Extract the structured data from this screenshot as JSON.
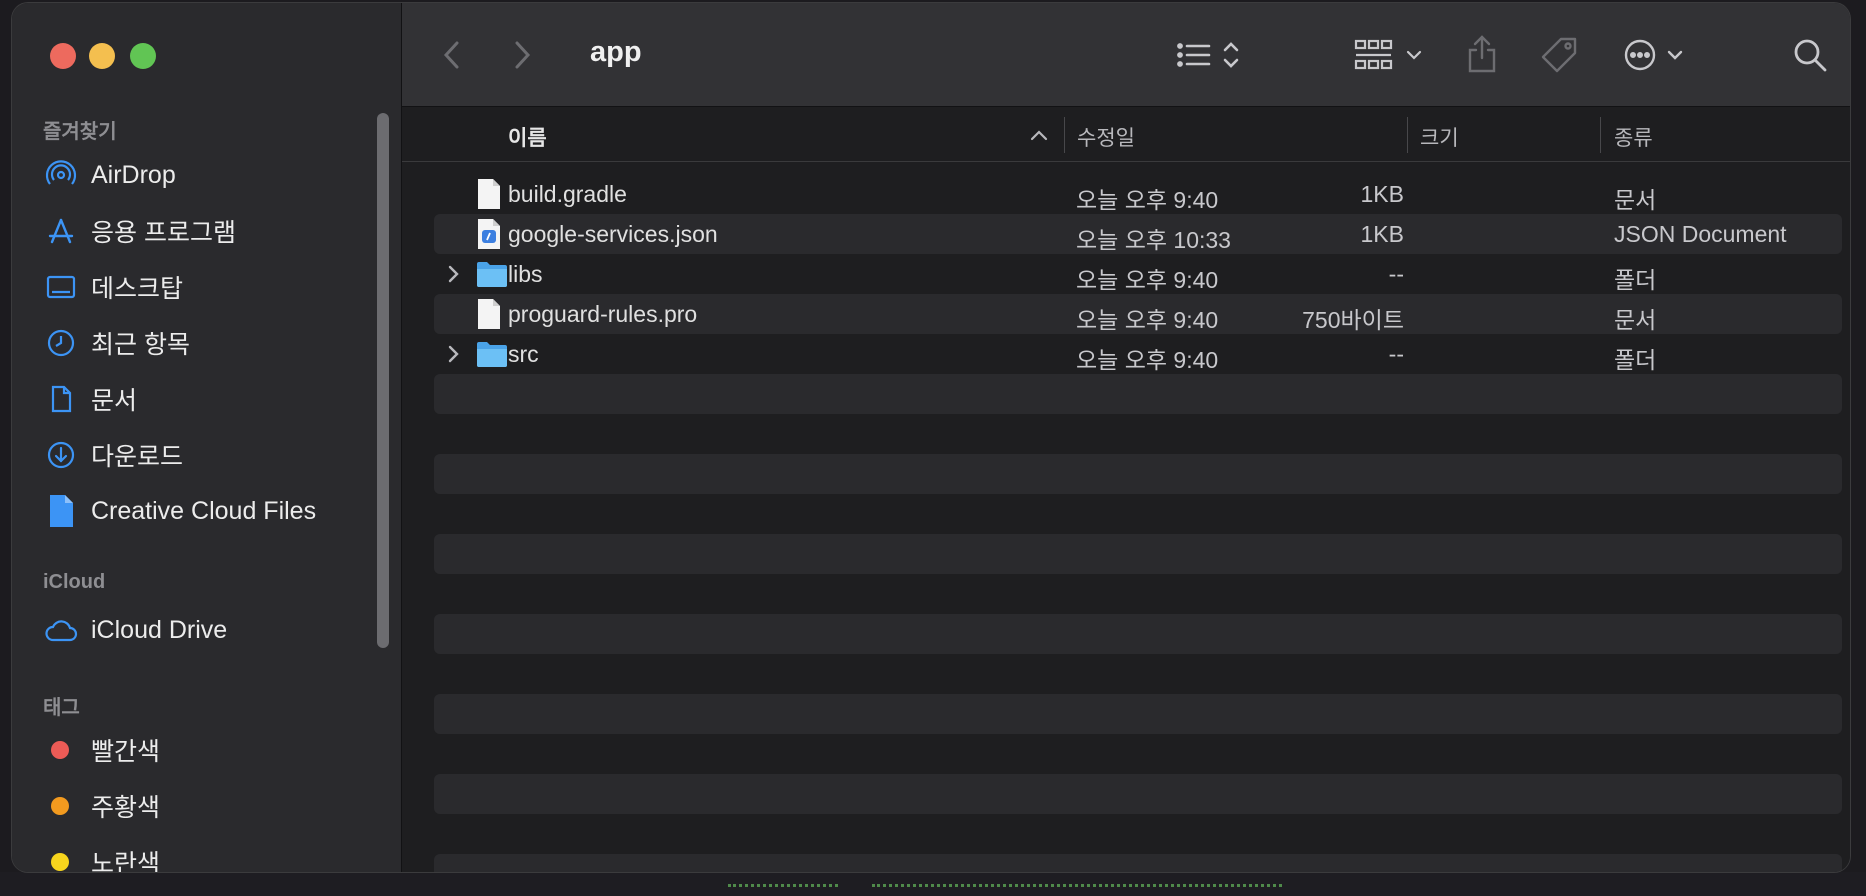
{
  "window": {
    "title": "app"
  },
  "sidebar": {
    "favorites_heading": "즐겨찾기",
    "favorites": [
      {
        "label": "AirDrop",
        "icon": "airdrop-icon"
      },
      {
        "label": "응용 프로그램",
        "icon": "applications-icon"
      },
      {
        "label": "데스크탑",
        "icon": "desktop-icon"
      },
      {
        "label": "최근 항목",
        "icon": "recents-clock-icon"
      },
      {
        "label": "문서",
        "icon": "document-icon"
      },
      {
        "label": "다운로드",
        "icon": "downloads-icon"
      },
      {
        "label": "Creative Cloud Files",
        "icon": "creative-cloud-file-icon"
      }
    ],
    "icloud_heading": "iCloud",
    "icloud": [
      {
        "label": "iCloud Drive",
        "icon": "icloud-icon"
      }
    ],
    "tags_heading": "태그",
    "tags": [
      {
        "label": "빨간색",
        "color": "#ec5b56"
      },
      {
        "label": "주황색",
        "color": "#f29a1f"
      },
      {
        "label": "노란색",
        "color": "#f7d51d"
      }
    ]
  },
  "toolbar": {
    "back": "chevron-left-icon",
    "forward": "chevron-right-icon",
    "view": "list-view-icon",
    "group": "grid-group-icon",
    "share": "share-icon",
    "tag": "tag-icon",
    "more": "ellipsis-icon",
    "search": "search-icon"
  },
  "columns": {
    "name": "이름",
    "date": "수정일",
    "size": "크기",
    "kind": "종류"
  },
  "files": [
    {
      "name": "build.gradle",
      "date": "오늘 오후 9:40",
      "size": "1KB",
      "kind": "문서",
      "type": "file",
      "expandable": false
    },
    {
      "name": "google-services.json",
      "date": "오늘 오후 10:33",
      "size": "1KB",
      "kind": "JSON Document",
      "type": "json",
      "expandable": false
    },
    {
      "name": "libs",
      "date": "오늘 오후 9:40",
      "size": "--",
      "kind": "폴더",
      "type": "folder",
      "expandable": true
    },
    {
      "name": "proguard-rules.pro",
      "date": "오늘 오후 9:40",
      "size": "750바이트",
      "kind": "문서",
      "type": "file",
      "expandable": false
    },
    {
      "name": "src",
      "date": "오늘 오후 9:40",
      "size": "--",
      "kind": "폴더",
      "type": "folder",
      "expandable": true
    }
  ],
  "colors": {
    "accent": "#3c94f5",
    "folder": "#5ab4f0"
  }
}
